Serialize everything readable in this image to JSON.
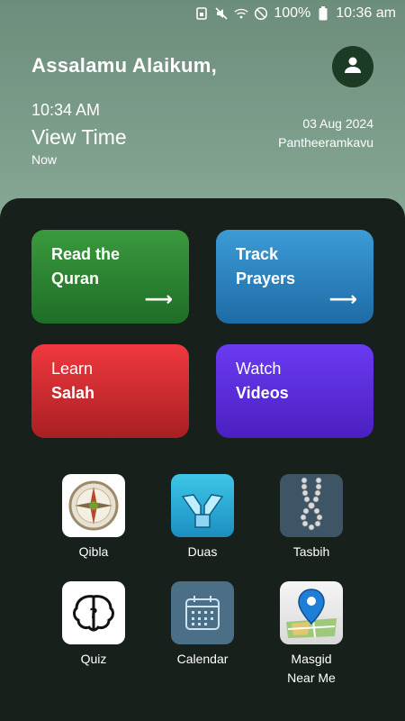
{
  "status_bar": {
    "battery": "100%",
    "time": "10:36 am"
  },
  "header": {
    "greeting": "Assalamu Alaikum,",
    "time": "10:34 AM",
    "time_label": "View Time",
    "time_sub": "Now",
    "date": "03 Aug 2024",
    "location": "Pantheeramkavu"
  },
  "cards": {
    "quran": {
      "line1": "Read the",
      "line2": "Quran",
      "arrow": "⟶"
    },
    "prayers": {
      "line1": "Track",
      "line2": "Prayers",
      "arrow": "⟶"
    },
    "salah": {
      "line1": "Learn",
      "line2": "Salah"
    },
    "videos": {
      "line1": "Watch",
      "line2": "Videos"
    }
  },
  "tiles": {
    "qibla": {
      "label": "Qibla",
      "icon": "compass-icon"
    },
    "duas": {
      "label": "Duas",
      "icon": "praying-hands-icon"
    },
    "tasbih": {
      "label": "Tasbih",
      "icon": "prayer-beads-icon"
    },
    "quiz": {
      "label": "Quiz",
      "icon": "brain-icon"
    },
    "calendar": {
      "label": "Calendar",
      "icon": "calendar-icon"
    },
    "masjid": {
      "label_line1": "Masgid",
      "label_line2": "Near Me",
      "icon": "map-pin-icon"
    }
  },
  "colors": {
    "header_bg": "#7a9c89",
    "panel_bg": "#17201b",
    "avatar_bg": "#1d3a24",
    "quran_card": "#2d8a33",
    "prayers_card": "#2d84c2",
    "salah_card": "#d52e33",
    "videos_card": "#5b2ddb"
  }
}
